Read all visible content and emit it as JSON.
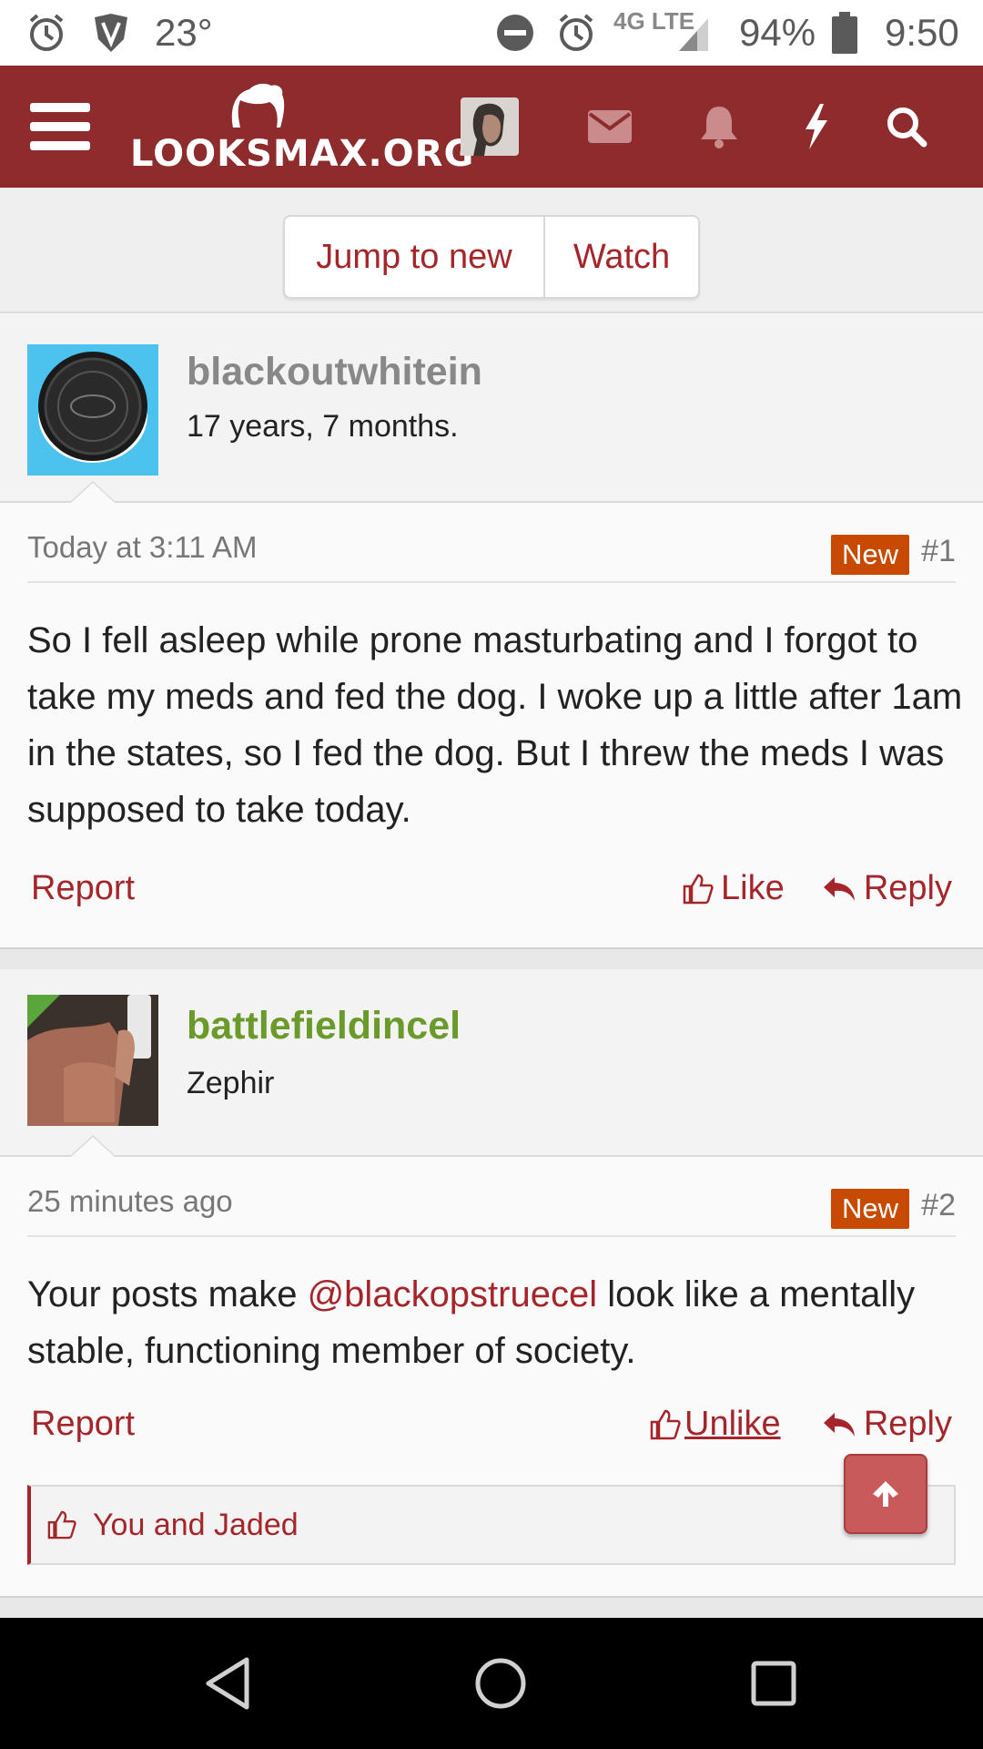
{
  "status_bar": {
    "temperature": "23°",
    "network": "4G LTE",
    "battery_percent": "94%",
    "time": "9:50",
    "icons": [
      "alarm-icon",
      "vpn-shield-icon",
      "do-not-disturb-icon",
      "alarm-icon",
      "signal-icon",
      "battery-icon"
    ]
  },
  "header": {
    "logo_text": "LOOKSMAX.ORG",
    "icons": [
      "menu-icon",
      "avatar",
      "mail-icon",
      "bell-icon",
      "lightning-icon",
      "search-icon"
    ],
    "color": "#8e2b2d"
  },
  "action_bar": {
    "jump_label": "Jump to new",
    "watch_label": "Watch"
  },
  "posts": [
    {
      "username": "blackoutwhitein",
      "username_color": "#888888",
      "user_title": "17 years, 7 months.",
      "date": "Today at 3:11 AM",
      "badge": "New",
      "number": "#1",
      "message": "So I fell asleep while prone masturbating and I forgot to take my meds and fed the dog. I woke up a little after 1am in the states, so I fed the dog. But I threw the meds I was supposed to take today.",
      "report_label": "Report",
      "like_label": "Like",
      "reply_label": "Reply"
    },
    {
      "username": "battlefieldincel",
      "username_color": "#6a9a2a",
      "user_title": "Zephir",
      "date": "25 minutes ago",
      "badge": "New",
      "number": "#2",
      "message_before": "Your posts make ",
      "mention": "@blackopstruecel",
      "message_after": " look like a mentally stable, functioning member of society.",
      "report_label": "Report",
      "like_label": "Unlike",
      "reply_label": "Reply",
      "likes_text": "You and Jaded"
    }
  ],
  "colors": {
    "accent": "#a5262a",
    "new_badge": "#c84a00"
  }
}
